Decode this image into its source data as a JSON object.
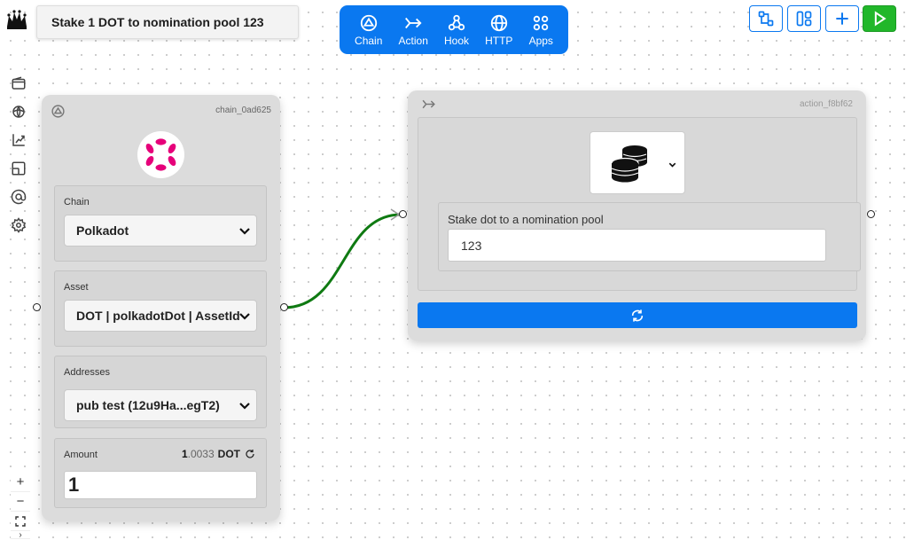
{
  "flow": {
    "title": "Stake 1 DOT to nomination pool 123"
  },
  "toolbar": {
    "items": [
      {
        "label": "Chain",
        "icon": "chain-icon"
      },
      {
        "label": "Action",
        "icon": "action-icon"
      },
      {
        "label": "Hook",
        "icon": "webhook-icon"
      },
      {
        "label": "HTTP",
        "icon": "globe-icon"
      },
      {
        "label": "Apps",
        "icon": "apps-grid-icon"
      }
    ]
  },
  "top_right": {
    "buttons": [
      {
        "name": "auto-layout-button",
        "icon": "network-icon"
      },
      {
        "name": "layout-toggle-button",
        "icon": "layout-columns-icon"
      },
      {
        "name": "add-node-button",
        "icon": "plus-icon"
      },
      {
        "name": "run-button",
        "icon": "play-icon"
      }
    ]
  },
  "sidebar": {
    "items": [
      {
        "name": "wallet",
        "icon": "wallet-icon"
      },
      {
        "name": "planet",
        "icon": "planet-icon"
      },
      {
        "name": "chart",
        "icon": "chart-up-icon"
      },
      {
        "name": "frame",
        "icon": "frame-icon"
      },
      {
        "name": "at",
        "icon": "at-icon"
      },
      {
        "name": "settings",
        "icon": "gear-icon"
      }
    ]
  },
  "chain_node": {
    "id": "chain_0ad625",
    "chain": {
      "label": "Chain",
      "value": "Polkadot"
    },
    "asset": {
      "label": "Asset",
      "value": "DOT | polkadotDot | AssetId"
    },
    "addresses": {
      "label": "Addresses",
      "value": "pub test (12u9Ha...egT2)"
    },
    "amount": {
      "label": "Amount",
      "balance_int": "1",
      "balance_dec": ".0033",
      "unit": "DOT",
      "value": "1"
    }
  },
  "action_node": {
    "id": "action_f8bf62",
    "param": {
      "label": "Stake dot to a nomination pool",
      "value": "123"
    }
  },
  "colors": {
    "primary": "#0a78f0",
    "run": "#21b72a",
    "edge": "#0f7a12",
    "polkadot": "#e6007a"
  },
  "zoom_controls": {
    "zoom_in": "+",
    "zoom_out": "−"
  }
}
